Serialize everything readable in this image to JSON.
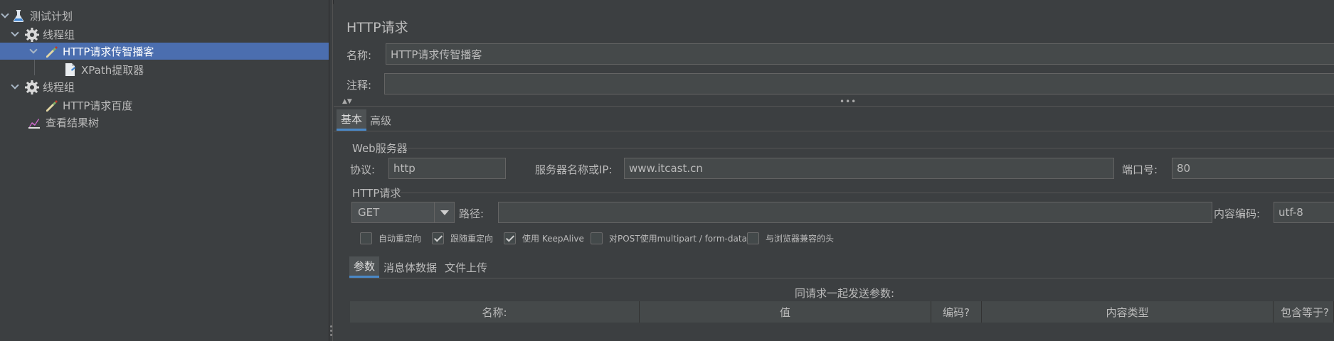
{
  "tree": {
    "items": [
      {
        "label": "测试计划",
        "icon": "flask-icon"
      },
      {
        "label": "线程组",
        "icon": "gear-icon"
      },
      {
        "label": "HTTP请求传智播客",
        "icon": "pipette-icon"
      },
      {
        "label": "XPath提取器",
        "icon": "document-icon"
      },
      {
        "label": "线程组",
        "icon": "gear-icon"
      },
      {
        "label": "HTTP请求百度",
        "icon": "pipette-icon"
      },
      {
        "label": "查看结果树",
        "icon": "chart-icon"
      }
    ]
  },
  "panel": {
    "title": "HTTP请求",
    "name_label": "名称:",
    "name_value": "HTTP请求传智播客",
    "comment_label": "注释:",
    "comment_value": ""
  },
  "tabs": {
    "basic": "基本",
    "advanced": "高级"
  },
  "web_server": {
    "group_title": "Web服务器",
    "protocol_label": "协议:",
    "protocol_value": "http",
    "server_label": "服务器名称或IP:",
    "server_value": "www.itcast.cn",
    "port_label": "端口号:",
    "port_value": "80"
  },
  "http_request": {
    "group_title": "HTTP请求",
    "method": "GET",
    "path_label": "路径:",
    "path_value": "",
    "encoding_label": "内容编码:",
    "encoding_value": "utf-8"
  },
  "checkboxes": [
    {
      "label": "自动重定向",
      "checked": false
    },
    {
      "label": "跟随重定向",
      "checked": true
    },
    {
      "label": "使用 KeepAlive",
      "checked": true
    },
    {
      "label": "对POST使用multipart / form-data",
      "checked": false
    },
    {
      "label": "与浏览器兼容的头",
      "checked": false
    }
  ],
  "subtabs": {
    "params": "参数",
    "body": "消息体数据",
    "files": "文件上传"
  },
  "params_caption": "同请求一起发送参数:",
  "table_headers": [
    "名称:",
    "值",
    "编码?",
    "内容类型",
    "包含等于?"
  ],
  "colors": {
    "selection": "#4b6eaf",
    "background": "#3c3f41",
    "field": "#45494a"
  }
}
